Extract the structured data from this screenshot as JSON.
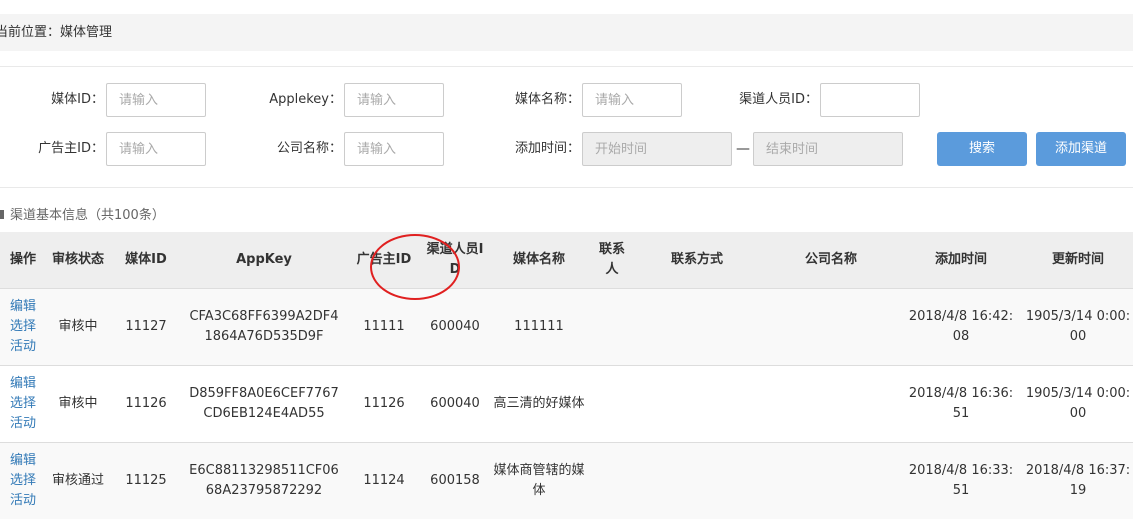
{
  "breadcrumb": {
    "text": "当前位置：媒体管理"
  },
  "filters": {
    "media_id_label": "媒体ID：",
    "applekey_label": "Applekey：",
    "media_name_label": "媒体名称：",
    "channel_staff_label": "渠道人员ID：",
    "advertiser_id_label": "广告主ID：",
    "company_name_label": "公司名称：",
    "add_time_label": "添加时间：",
    "placeholder": "请输入",
    "start_time_placeholder": "开始时间",
    "end_time_placeholder": "结束时间",
    "dash": "—",
    "search_label": "搜索",
    "add_channel_label": "添加渠道"
  },
  "section": {
    "title": "渠道基本信息（共100条）"
  },
  "table": {
    "headers": {
      "action": "操作",
      "review_status": "审核状态",
      "media_id": "媒体ID",
      "appkey": "AppKey",
      "advertiser_id": "广告主ID",
      "channel_staff_id": "渠道人员ID",
      "media_name": "媒体名称",
      "contact": "联系人",
      "contact_method": "联系方式",
      "company_name": "公司名称",
      "add_time": "添加时间",
      "update_time": "更新时间"
    },
    "rows": [
      {
        "edit": "编辑",
        "select_activity": "选择活动",
        "status": "审核中",
        "media_id": "11127",
        "appkey": "CFA3C68FF6399A2DF41864A76D535D9F",
        "advertiser_id": "11111",
        "channel_staff_id": "600040",
        "media_name": "111111",
        "contact": "",
        "contact_method": "",
        "company_name": "",
        "add_time": "2018/4/8 16:42:08",
        "update_time": "1905/3/14 0:00:00"
      },
      {
        "edit": "编辑",
        "select_activity": "选择活动",
        "status": "审核中",
        "media_id": "11126",
        "appkey": "D859FF8A0E6CEF7767CD6EB124E4AD55",
        "advertiser_id": "11126",
        "channel_staff_id": "600040",
        "media_name": "高三清的好媒体",
        "contact": "",
        "contact_method": "",
        "company_name": "",
        "add_time": "2018/4/8 16:36:51",
        "update_time": "1905/3/14 0:00:00"
      },
      {
        "edit": "编辑",
        "select_activity": "选择活动",
        "status": "审核通过",
        "media_id": "11125",
        "appkey": "E6C88113298511CF0668A23795872292",
        "advertiser_id": "11124",
        "channel_staff_id": "600158",
        "media_name": "媒体商管辖的媒体",
        "contact": "",
        "contact_method": "",
        "company_name": "",
        "add_time": "2018/4/8 16:33:51",
        "update_time": "2018/4/8 16:37:19"
      }
    ]
  },
  "colors": {
    "primary_button": "#5b9bdc",
    "link": "#337ab7",
    "annotation": "#e02020"
  }
}
